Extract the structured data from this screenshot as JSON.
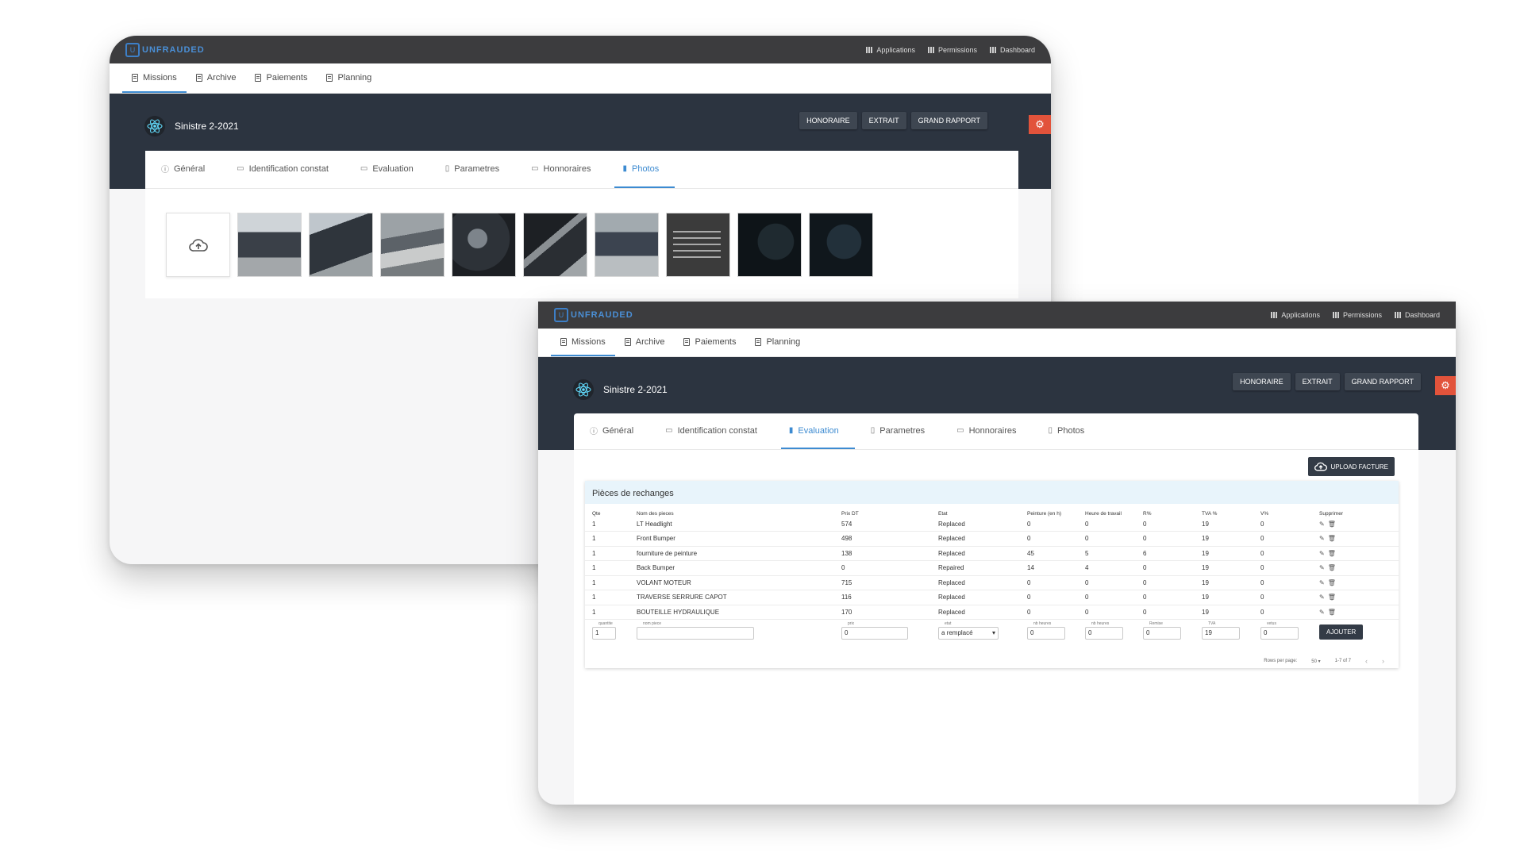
{
  "brand": "UNFRAUDED",
  "top_links": [
    "Applications",
    "Permissions",
    "Dashboard"
  ],
  "nav": [
    "Missions",
    "Archive",
    "Paiements",
    "Planning"
  ],
  "mission_title": "Sinistre 2-2021",
  "hero_buttons": [
    "HONORAIRE",
    "EXTRAIT",
    "GRAND RAPPORT"
  ],
  "tabs": [
    "Général",
    "Identification constat",
    "Evaluation",
    "Parametres",
    "Honnoraires",
    "Photos"
  ],
  "back_active_tab": "Photos",
  "front_active_tab": "Evaluation",
  "photo_count": 9,
  "upload_facture_label": "UPLOAD FACTURE",
  "card_title": "Pièces de rechanges",
  "table": {
    "headers": [
      "Qte",
      "Nom des pieces",
      "Prix DT",
      "Etat",
      "Peinture (en h)",
      "Heure de travail",
      "R%",
      "TVA %",
      "V%",
      "Supprimer"
    ],
    "rows": [
      [
        "1",
        "LT Headlight",
        "574",
        "Replaced",
        "0",
        "0",
        "0",
        "19",
        "0"
      ],
      [
        "1",
        "Front Bumper",
        "498",
        "Replaced",
        "0",
        "0",
        "0",
        "19",
        "0"
      ],
      [
        "1",
        "fourniture de peinture",
        "138",
        "Replaced",
        "45",
        "5",
        "6",
        "19",
        "0"
      ],
      [
        "1",
        "Back Bumper",
        "0",
        "Repaired",
        "14",
        "4",
        "0",
        "19",
        "0"
      ],
      [
        "1",
        "VOLANT MOTEUR",
        "715",
        "Replaced",
        "0",
        "0",
        "0",
        "19",
        "0"
      ],
      [
        "1",
        "TRAVERSE SERRURE CAPOT",
        "116",
        "Replaced",
        "0",
        "0",
        "0",
        "19",
        "0"
      ],
      [
        "1",
        "BOUTEILLE HYDRAULIQUE",
        "170",
        "Replaced",
        "0",
        "0",
        "0",
        "19",
        "0"
      ]
    ]
  },
  "form": {
    "qte": {
      "label": "quantite",
      "value": "1"
    },
    "nom": {
      "label": "nom piece",
      "value": ""
    },
    "prix": {
      "label": "prix",
      "value": "0"
    },
    "etat": {
      "label": "etat",
      "value": "a remplacé"
    },
    "peinture": {
      "label": "nb heures",
      "value": "0"
    },
    "travail": {
      "label": "nb heures",
      "value": "0"
    },
    "remise": {
      "label": "Remise",
      "value": "0"
    },
    "tva": {
      "label": "TVA",
      "value": "19"
    },
    "vetus": {
      "label": "vetus",
      "value": "0"
    },
    "add_label": "AJOUTER"
  },
  "pager": {
    "rows_label": "Rows per page:",
    "rows_value": "50",
    "range": "1-7 of 7"
  },
  "colors": {
    "topbar": "#3c3c3e",
    "hero": "#2c3440",
    "accent": "#3d8bd1",
    "gear": "#e2533b",
    "dark_button": "#333b46"
  }
}
